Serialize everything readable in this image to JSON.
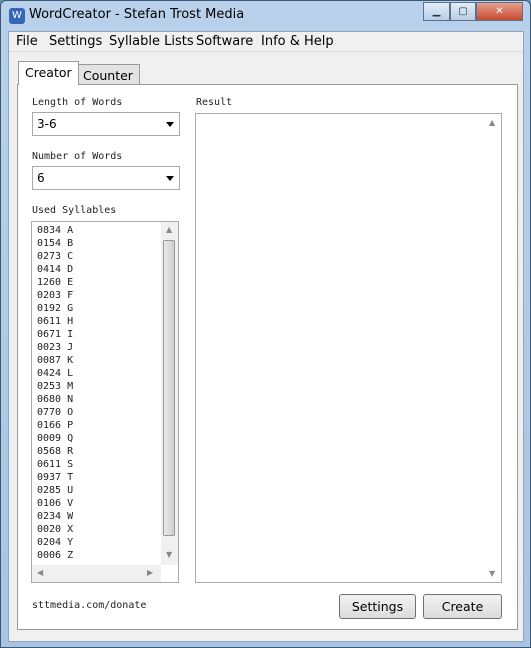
{
  "window": {
    "title": "WordCreator - Stefan Trost Media",
    "icon": "app-icon"
  },
  "menu": [
    "File",
    "Settings",
    "Syllable Lists",
    "Software",
    "Info & Help"
  ],
  "tabs": [
    {
      "label": "Creator",
      "active": true
    },
    {
      "label": "Counter",
      "active": false
    }
  ],
  "creator": {
    "length_label": "Length of Words",
    "length_value": "3-6",
    "number_label": "Number of Words",
    "number_value": "6",
    "syllables_label": "Used Syllables",
    "syllables": [
      "0834 A",
      "0154 B",
      "0273 C",
      "0414 D",
      "1260 E",
      "0203 F",
      "0192 G",
      "0611 H",
      "0671 I",
      "0023 J",
      "0087 K",
      "0424 L",
      "0253 M",
      "0680 N",
      "0770 O",
      "0166 P",
      "0009 Q",
      "0568 R",
      "0611 S",
      "0937 T",
      "0285 U",
      "0106 V",
      "0234 W",
      "0020 X",
      "0204 Y",
      "0006 Z"
    ],
    "result_label": "Result",
    "result_value": ""
  },
  "footer": {
    "link": "sttmedia.com/donate",
    "settings_button": "Settings",
    "create_button": "Create"
  }
}
